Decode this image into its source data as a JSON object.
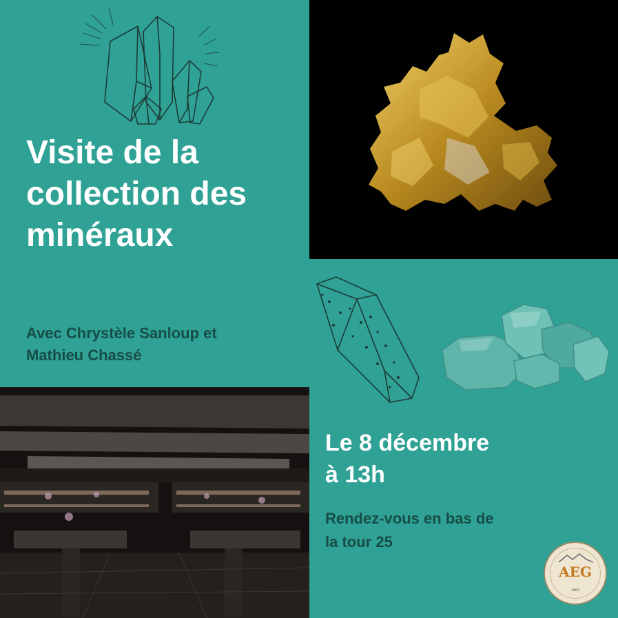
{
  "title_lines": [
    "Visite de la",
    "collection des",
    "minéraux"
  ],
  "subtitle_lines": [
    "Avec Chrystèle Sanloup et",
    "Mathieu Chassé"
  ],
  "date_lines": [
    "Le  8  décembre",
    "à 13h"
  ],
  "meeting_lines": [
    "Rendez-vous en bas de",
    "la tour 25"
  ],
  "logo": {
    "text": "AEG",
    "year": "1985"
  },
  "colors": {
    "background": "#2fa195",
    "title": "#ffffff",
    "accent_text": "#174d47",
    "gold": "#c9a233"
  },
  "icons": [
    "crystal-cluster-icon",
    "crystal-prism-icon",
    "gemstone-rocks-icon",
    "gold-nugget-photo",
    "mineral-gallery-photo"
  ]
}
